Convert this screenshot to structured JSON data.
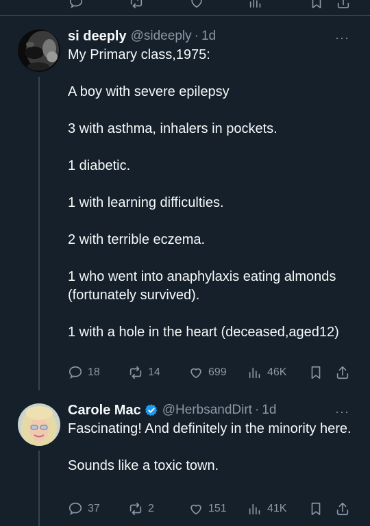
{
  "tweets": [
    {
      "name": "si deeply",
      "handle": "@sideeply",
      "time": "1d",
      "more": "···",
      "paragraphs": [
        "My Primary class,1975:",
        "A boy with severe epilepsy",
        "3 with asthma, inhalers in pockets.",
        "1 diabetic.",
        "1 with learning difficulties.",
        "2 with terrible eczema.",
        "1 who went into anaphylaxis eating almonds (fortunately survived).",
        "1 with a hole in the heart (deceased,aged12)"
      ],
      "replies": "18",
      "retweets": "14",
      "likes": "699",
      "views": "46K"
    },
    {
      "name": "Carole Mac",
      "verified": true,
      "handle": "@HerbsandDirt",
      "time": "1d",
      "more": "···",
      "paragraphs": [
        "Fascinating! And definitely in the minority here.",
        "Sounds like a toxic town."
      ],
      "replies": "37",
      "retweets": "2",
      "likes": "151",
      "views": "41K"
    }
  ],
  "colors": {
    "background": "#15202b",
    "text": "#f7f9f9",
    "muted": "#8b98a5",
    "verified": "#1d9bf0",
    "divider": "#38444d"
  }
}
